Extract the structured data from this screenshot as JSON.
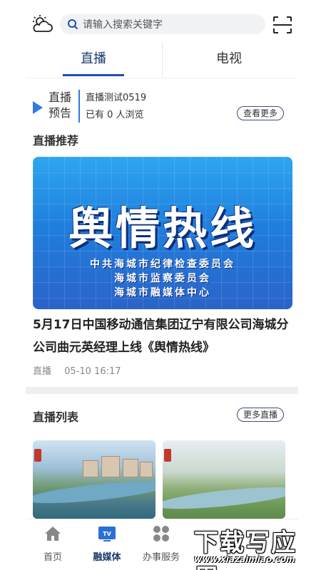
{
  "search": {
    "placeholder": "请输入搜索关键字"
  },
  "tabs": [
    {
      "label": "直播",
      "active": true
    },
    {
      "label": "电视",
      "active": false
    }
  ],
  "preview": {
    "label_line1": "直播",
    "label_line2": "预告",
    "title": "直播测试0519",
    "viewers": "已有 0 人浏览",
    "more_label": "查看更多"
  },
  "recommend": {
    "heading": "直播推荐",
    "banner_title": "舆情热线",
    "banner_lines": [
      "中共海城市纪律检查委员会",
      "海城市监察委员会",
      "海城市融媒体中心"
    ],
    "news_title": "5月17日中国移动通信集团辽宁有限公司海城分公司曲元英经理上线《舆情热线》",
    "category": "直播",
    "time": "05-10 16:17"
  },
  "live_list": {
    "heading": "直播列表",
    "more_label": "更多直播"
  },
  "bottom_nav": [
    {
      "label": "首页",
      "icon": "home-icon",
      "active": false
    },
    {
      "label": "融媒体",
      "icon": "tv-icon",
      "active": true
    },
    {
      "label": "办事服务",
      "icon": "grid-icon",
      "active": false
    }
  ],
  "overlay_watermark": {
    "text": "下载写应用",
    "url": "www.xiazaimiao.com"
  },
  "colors": {
    "accent": "#1f4fb3",
    "play": "#2d7be0",
    "banner": "#1f7fde"
  }
}
